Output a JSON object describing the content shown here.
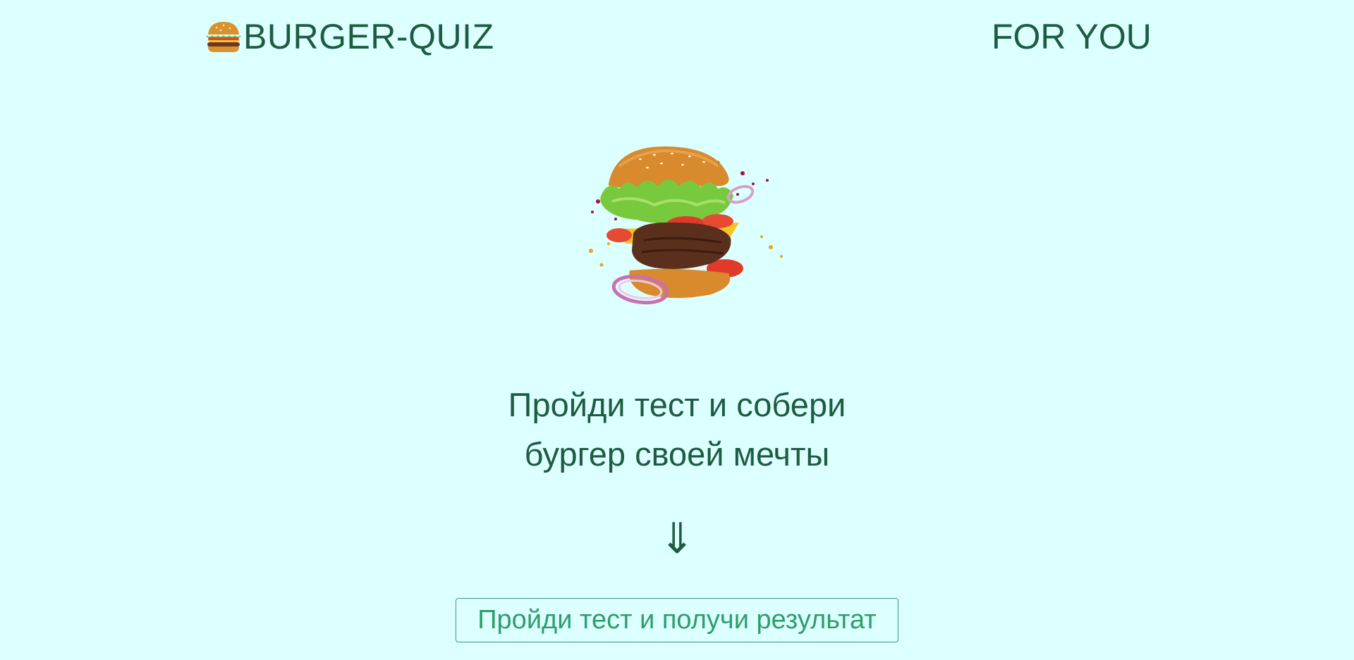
{
  "header": {
    "logo_text": "BURGER-QUIZ",
    "logo_icon": "burger-icon",
    "tagline": "FOR YOU"
  },
  "hero": {
    "image": "flying-burger-illustration"
  },
  "main": {
    "headline_line1": "Пройди тест и собери",
    "headline_line2": "бургер своей мечты",
    "arrow": "⇓",
    "cta_label": "Пройди тест и получи результат"
  },
  "colors": {
    "background": "#dcffff",
    "text": "#1d5c3f",
    "accent": "#2e9e6a"
  }
}
